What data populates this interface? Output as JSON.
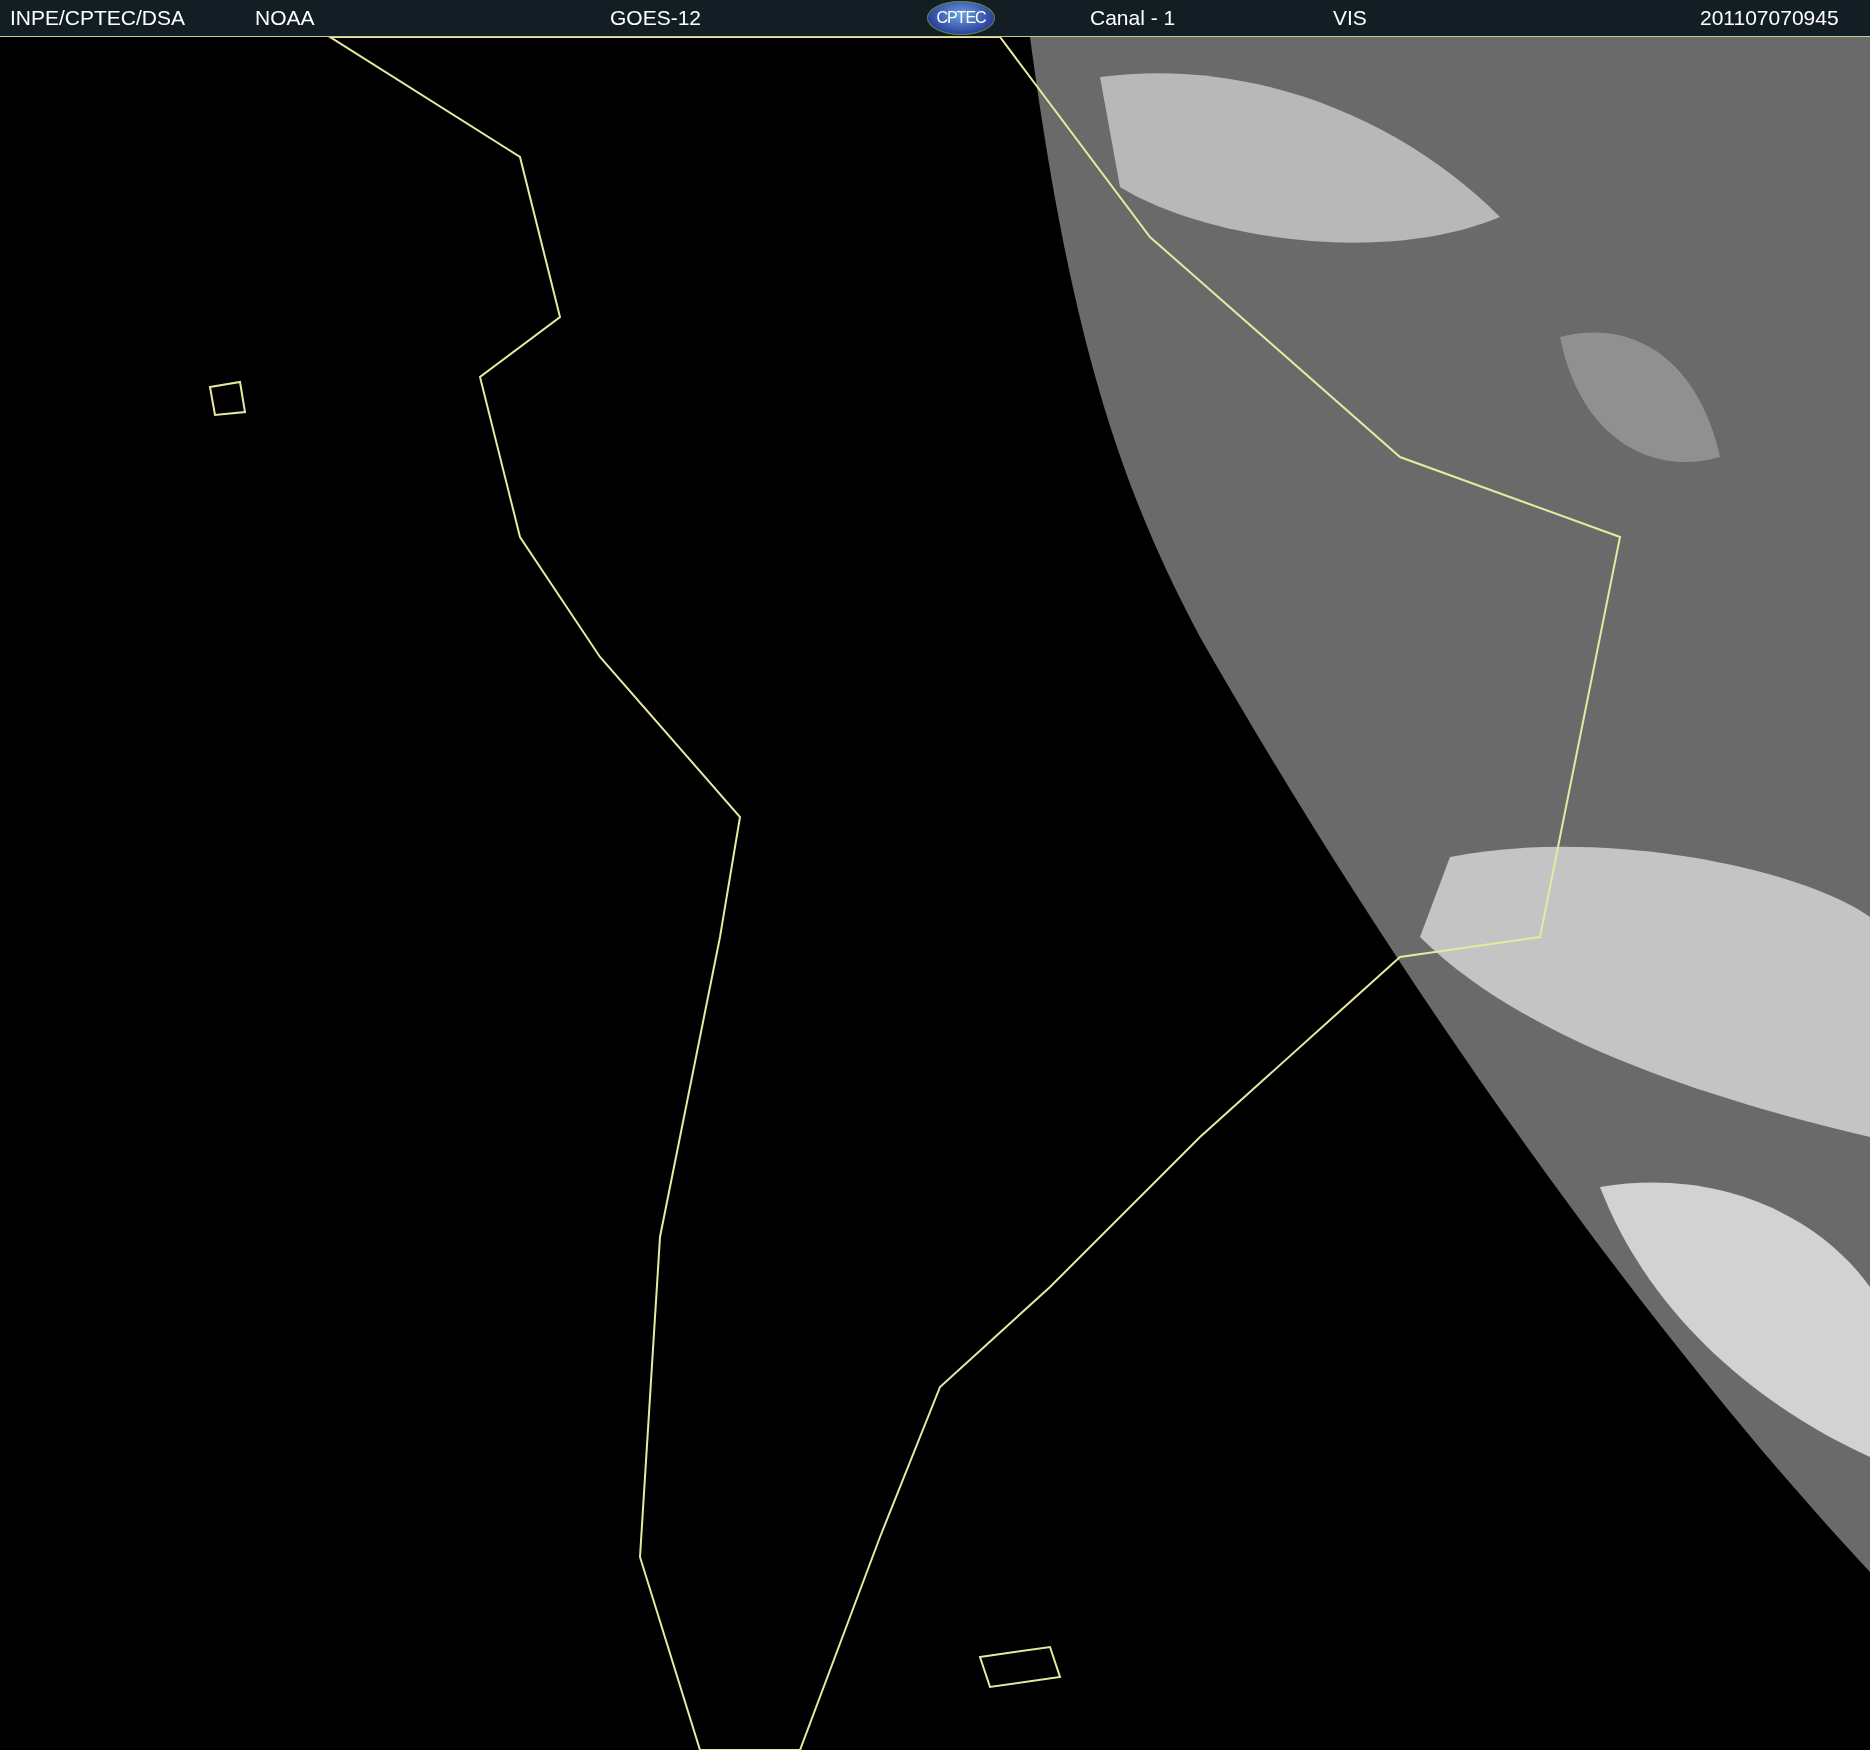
{
  "header": {
    "source": "INPE/CPTEC/DSA",
    "agency": "NOAA",
    "satellite": "GOES-12",
    "logo": "CPTEC",
    "channel": "Canal - 1",
    "band": "VIS",
    "timestamp": "201107070945"
  }
}
